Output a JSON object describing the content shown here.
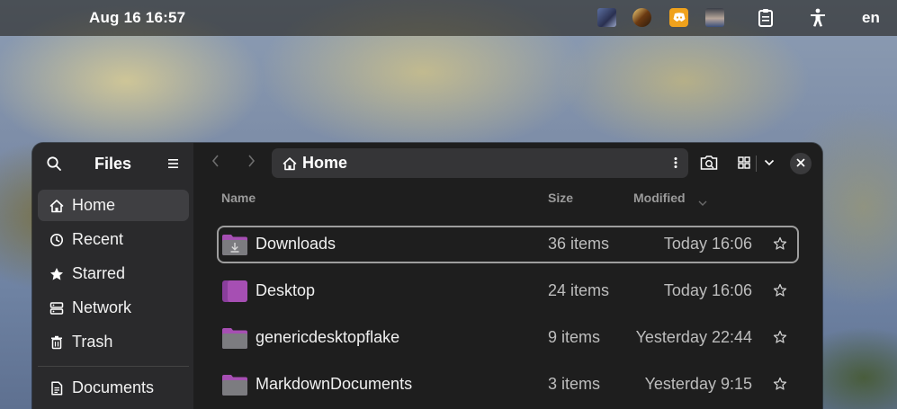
{
  "topbar": {
    "clock": "Aug 16  16:57",
    "language": "en",
    "tray_icons": [
      "app-thumbnail-icon",
      "vlc-like-icon",
      "discord-icon",
      "avatar-icon",
      "clipboard-icon",
      "accessibility-icon"
    ]
  },
  "sidebar": {
    "title": "Files",
    "items": [
      {
        "label": "Home",
        "icon": "home-icon",
        "active": true
      },
      {
        "label": "Recent",
        "icon": "clock-icon",
        "active": false
      },
      {
        "label": "Starred",
        "icon": "star-icon",
        "active": false
      },
      {
        "label": "Network",
        "icon": "network-icon",
        "active": false
      },
      {
        "label": "Trash",
        "icon": "trash-icon",
        "active": false
      },
      {
        "label": "Documents",
        "icon": "document-icon",
        "active": false
      }
    ]
  },
  "header": {
    "path_label": "Home"
  },
  "columns": {
    "name": "Name",
    "size": "Size",
    "modified": "Modified"
  },
  "files": [
    {
      "name": "Downloads",
      "size": "36 items",
      "modified": "Today 16:06",
      "icon": "downloads-folder-icon",
      "selected": true
    },
    {
      "name": "Desktop",
      "size": "24 items",
      "modified": "Today 16:06",
      "icon": "desktop-folder-icon",
      "selected": false
    },
    {
      "name": "genericdesktopflake",
      "size": "9 items",
      "modified": "Yesterday 22:44",
      "icon": "folder-icon",
      "selected": false
    },
    {
      "name": "MarkdownDocuments",
      "size": "3 items",
      "modified": "Yesterday 9:15",
      "icon": "folder-icon",
      "selected": false
    }
  ],
  "colors": {
    "accent_folder": "#a64fb3",
    "folder_body": "#7c7c80",
    "window_bg": "#1e1e1e",
    "sidebar_bg": "#2a2a2c"
  }
}
